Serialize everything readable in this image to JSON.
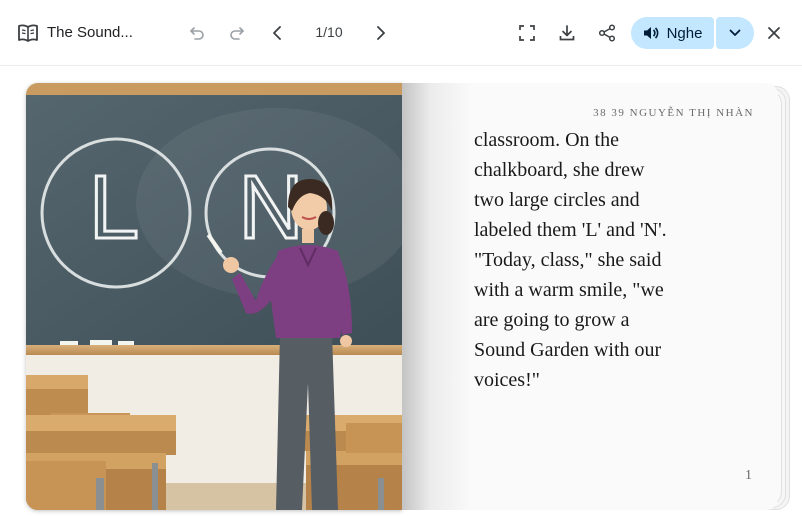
{
  "toolbar": {
    "title": "The Sound...",
    "page_indicator": "1/10",
    "listen_label": "Nghe"
  },
  "illustration": {
    "board_letters": [
      "L",
      "N"
    ]
  },
  "right_page": {
    "header": "38 39 NGUYỄN THỊ NHÀN",
    "lines": [
      "classroom. On the",
      "chalkboard, she drew",
      "two large circles and",
      "labeled them 'L' and 'N'.",
      "\"Today, class,\" she said",
      "with a warm smile, \"we",
      "are going to grow a",
      "Sound Garden with our",
      "voices!\""
    ],
    "page_number": "1"
  },
  "colors": {
    "listen_bg": "#c2e7ff",
    "chalkboard": "#4a5b63",
    "blouse": "#7d3f82"
  }
}
